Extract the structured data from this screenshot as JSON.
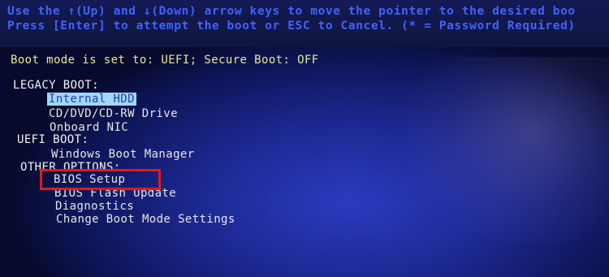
{
  "colors": {
    "instruction_text": "#3f63ff",
    "boot_mode_text": "#e8e79a",
    "menu_text": "#e6e6e6",
    "selection_background": "#9fd8ff",
    "highlight_box": "#e01a1a"
  },
  "instructions": {
    "line1": "Use the ↑(Up) and ↓(Down) arrow keys to move the pointer to the desired boo",
    "line2": "Press [Enter] to attempt the boot or ESC to Cancel. (* = Password Required)"
  },
  "boot_mode": "Boot mode is set to: UEFI; Secure Boot: OFF",
  "legacy_boot": {
    "header": "LEGACY BOOT:",
    "items": [
      "Internal HDD",
      "CD/DVD/CD-RW Drive",
      "Onboard NIC"
    ]
  },
  "uefi_boot": {
    "header": "UEFI BOOT:",
    "items": [
      "Windows Boot Manager"
    ]
  },
  "other_options": {
    "header": "OTHER OPTIONS:",
    "items": [
      "BIOS Setup",
      "BIOS Flash Update",
      "Diagnostics",
      "Change Boot Mode Settings"
    ]
  },
  "selected_item": "Internal HDD",
  "highlighted_item": "BIOS Setup"
}
